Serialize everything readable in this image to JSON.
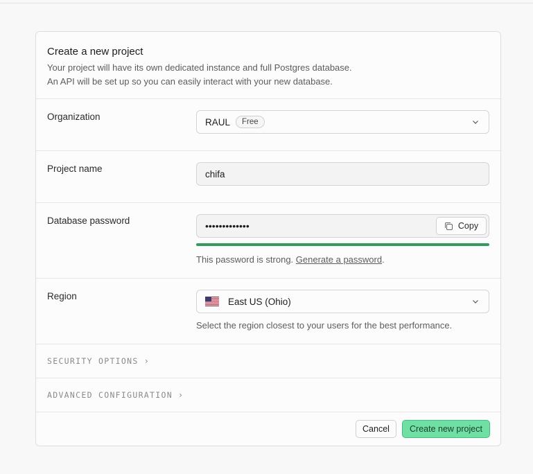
{
  "header": {
    "title": "Create a new project",
    "desc_line1": "Your project will have its own dedicated instance and full Postgres database.",
    "desc_line2": "An API will be set up so you can easily interact with your new database."
  },
  "organization": {
    "label": "Organization",
    "value": "RAUL",
    "plan_badge": "Free"
  },
  "project_name": {
    "label": "Project name",
    "value": "chifa"
  },
  "db_password": {
    "label": "Database password",
    "masked_value": "•••••••••••••",
    "copy_label": "Copy",
    "strength": 1.0,
    "strength_color": "#2e9e5d",
    "help_prefix": "This password is strong.",
    "generate_link": "Generate a password",
    "help_suffix": "."
  },
  "region": {
    "label": "Region",
    "value": "East US (Ohio)",
    "flag_icon": "us-flag-icon",
    "help": "Select the region closest to your users for the best performance."
  },
  "sections": {
    "security": "SECURITY OPTIONS",
    "advanced": "ADVANCED CONFIGURATION"
  },
  "footer": {
    "cancel_label": "Cancel",
    "create_label": "Create new project"
  },
  "colors": {
    "accent": "#6ee0a3",
    "accent_border": "#3fbf7f"
  }
}
